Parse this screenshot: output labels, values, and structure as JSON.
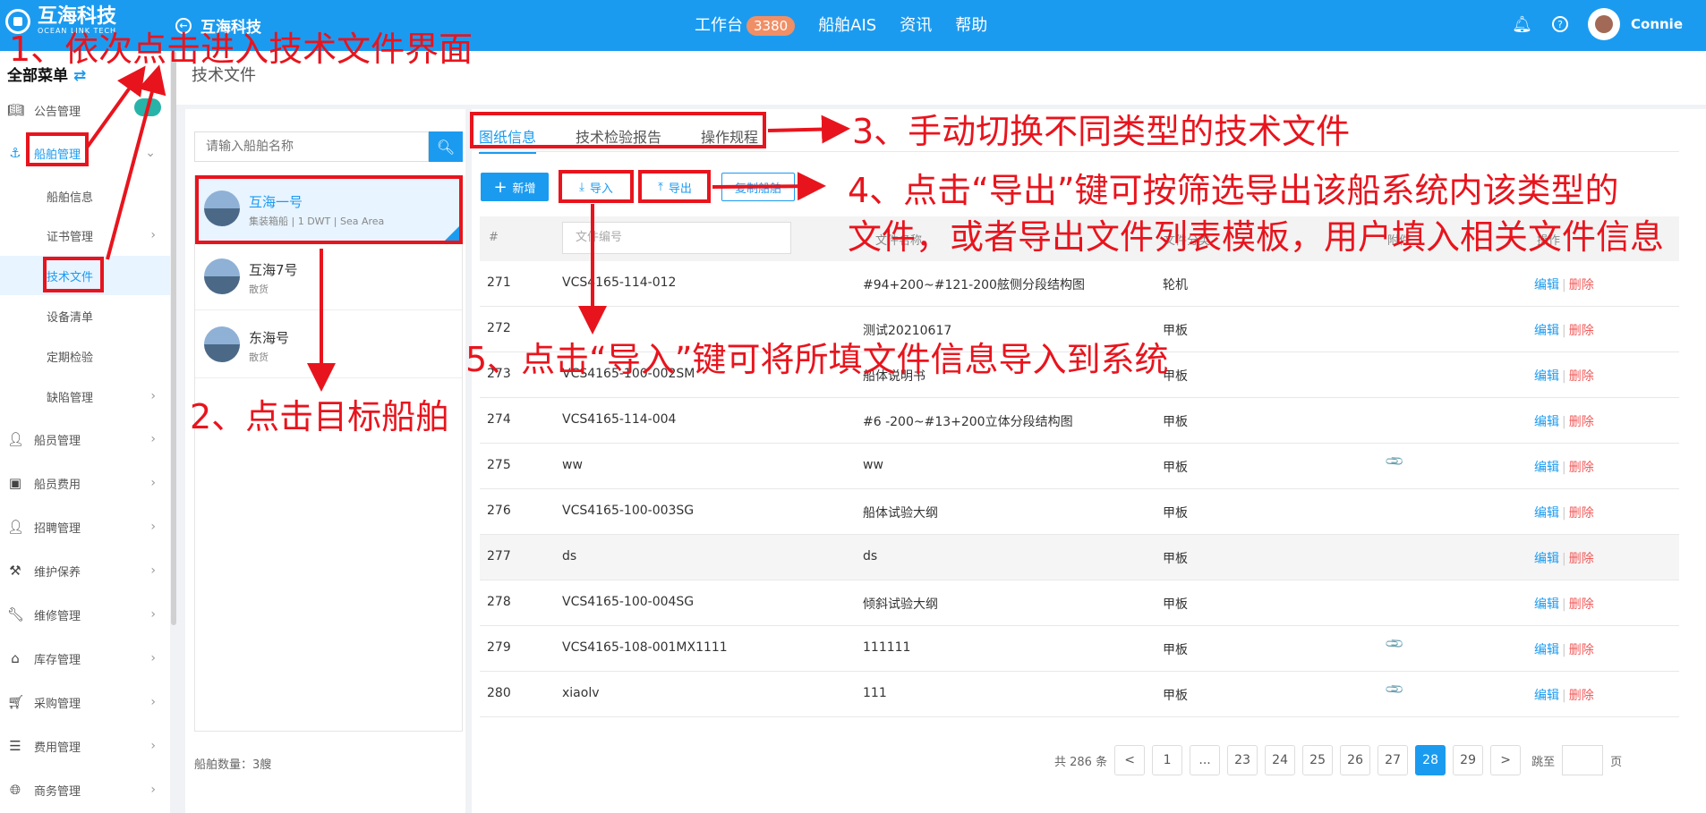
{
  "header": {
    "logo_text": "互海科技",
    "logo_sub": "OCEAN LINK TECH",
    "back_label": "互海科技",
    "nav": [
      {
        "label": "工作台",
        "badge": "3380"
      },
      {
        "label": "船舶AIS"
      },
      {
        "label": "资讯"
      },
      {
        "label": "帮助"
      }
    ],
    "user_name": "Connie"
  },
  "sidebar": {
    "title": "全部菜单",
    "items": [
      {
        "label": "公告管理",
        "icon": "book-icon"
      },
      {
        "label": "船舶管理",
        "icon": "anchor-icon"
      },
      {
        "label": "船舶信息"
      },
      {
        "label": "证书管理"
      },
      {
        "label": "技术文件"
      },
      {
        "label": "设备清单"
      },
      {
        "label": "定期检验"
      },
      {
        "label": "缺陷管理"
      },
      {
        "label": "船员管理",
        "icon": "person-icon"
      },
      {
        "label": "船员费用",
        "icon": "wallet-icon"
      },
      {
        "label": "招聘管理",
        "icon": "person-icon"
      },
      {
        "label": "维护保养",
        "icon": "hammer-icon"
      },
      {
        "label": "维修管理",
        "icon": "wrench-icon"
      },
      {
        "label": "库存管理",
        "icon": "home-icon"
      },
      {
        "label": "采购管理",
        "icon": "cart-icon"
      },
      {
        "label": "费用管理",
        "icon": "database-icon"
      },
      {
        "label": "商务管理",
        "icon": "globe-icon"
      }
    ]
  },
  "breadcrumb": "技术文件",
  "ship_panel": {
    "search_placeholder": "请输入船舶名称",
    "ships": [
      {
        "name": "互海一号",
        "desc": "集装箱船 | 1 DWT | Sea Area"
      },
      {
        "name": "互海7号",
        "desc": "散货"
      },
      {
        "name": "东海号",
        "desc": "散货"
      }
    ],
    "count_label": "船舶数量：3艘"
  },
  "tabs": [
    "图纸信息",
    "技术检验报告",
    "操作规程"
  ],
  "toolbar": {
    "add": "新增",
    "import": "导入",
    "export": "导出",
    "copy": "复制船舶"
  },
  "table": {
    "headers": {
      "index": "#",
      "file_no_placeholder": "文件编号",
      "file_name": "文件名称",
      "category": "文件分类",
      "attachment": "附件",
      "action": "操作"
    },
    "rows": [
      {
        "no": "271",
        "code": "VCS4165-114-012",
        "name": "#94+200~#121-200舷侧分段结构图",
        "cat": "轮机",
        "clip": ""
      },
      {
        "no": "272",
        "code": "",
        "name": "测试20210617",
        "cat": "甲板",
        "clip": ""
      },
      {
        "no": "273",
        "code": "VCS4165-100-002SM",
        "name": "船体说明书",
        "cat": "甲板",
        "clip": ""
      },
      {
        "no": "274",
        "code": "VCS4165-114-004",
        "name": "#6 -200~#13+200立体分段结构图",
        "cat": "甲板",
        "clip": ""
      },
      {
        "no": "275",
        "code": "ww",
        "name": "ww",
        "cat": "甲板",
        "clip": "📎"
      },
      {
        "no": "276",
        "code": "VCS4165-100-003SG",
        "name": "船体试验大纲",
        "cat": "甲板",
        "clip": ""
      },
      {
        "no": "277",
        "code": "ds",
        "name": "ds",
        "cat": "甲板",
        "clip": ""
      },
      {
        "no": "278",
        "code": "VCS4165-100-004SG",
        "name": "倾斜试验大纲",
        "cat": "甲板",
        "clip": ""
      },
      {
        "no": "279",
        "code": "VCS4165-108-001MX1111",
        "name": "111111",
        "cat": "甲板",
        "clip": "📎"
      },
      {
        "no": "280",
        "code": "xiaolv",
        "name": "111",
        "cat": "甲板",
        "clip": "📎"
      }
    ],
    "edit_label": "编辑",
    "delete_label": "删除"
  },
  "pagination": {
    "total": "共 286 条",
    "prev": "<",
    "pages": [
      "1",
      "...",
      "23",
      "24",
      "25",
      "26",
      "27",
      "28",
      "29"
    ],
    "current": "28",
    "next": ">",
    "goto": "跳至",
    "page_unit": "页"
  },
  "annotations": {
    "a1": "1、依次点击进入技术文件界面",
    "a2": "2、点击目标船舶",
    "a3": "3、手动切换不同类型的技术文件",
    "a4_line1": "4、点击“导出”键可按筛选导出该船系统内该类型的",
    "a4_line2": "文件，或者导出文件列表模板，用户填入相关文件信息",
    "a5": "5、点击“导入”键可将所填文件信息导入到系统"
  },
  "colors": {
    "brand": "#1b9bf0",
    "annotation": "#e8141d",
    "delete": "#f25a5a",
    "badge": "#f08f66"
  }
}
